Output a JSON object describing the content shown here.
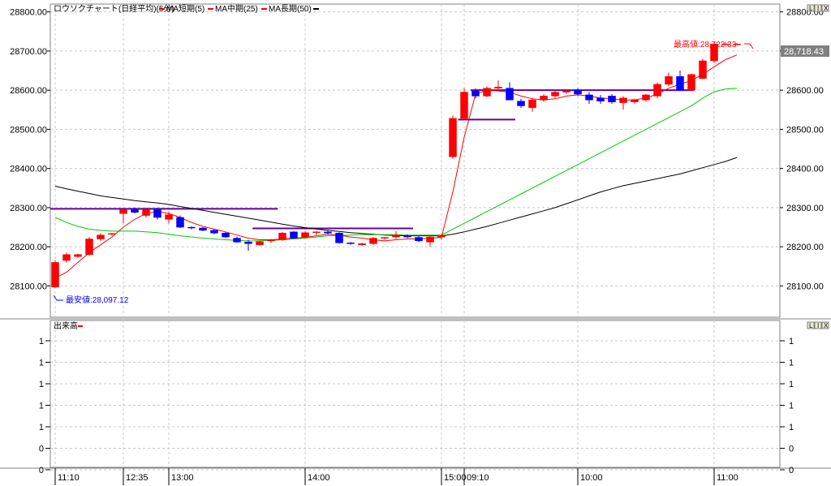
{
  "main_panel": {
    "title": "ロウソクチャート(日経平均)(5分)",
    "legend": [
      {
        "label": "MA短期(5)",
        "color": "#ff0000"
      },
      {
        "label": "MA中期(25)",
        "color": "#ff0000"
      },
      {
        "label": "MA長期(50)",
        "color": "#000000"
      }
    ],
    "buttons": [
      "L",
      "I",
      "X"
    ],
    "y_ticks": [
      "28800.00",
      "28700.00",
      "28600.00",
      "28500.00",
      "28400.00",
      "28300.00",
      "28200.00",
      "28100.00"
    ],
    "current_price_label": "28,718.43",
    "high_annotation": "最高値:28,722.33",
    "low_annotation": "最安値:28,097.12"
  },
  "volume_panel": {
    "title": "出来高",
    "buttons": [
      "L",
      "I",
      "X"
    ],
    "y_ticks": [
      "1",
      "1",
      "1",
      "1",
      "1",
      "0",
      "0",
      "0"
    ]
  },
  "x_axis": {
    "labels": [
      "11:10",
      "12:35",
      "13:00",
      "14:00",
      "15:00",
      "09:10",
      "10:00",
      "11:00"
    ]
  },
  "colors": {
    "up": "#ff0000",
    "down": "#0000ff",
    "ma_short": "#ff0000",
    "ma_mid": "#00cc00",
    "ma_long": "#000000",
    "hline": "#660099",
    "grid": "#c8c8c8"
  },
  "chart_data": {
    "type": "candlestick",
    "ylim": [
      28020,
      28820
    ],
    "candles": [
      {
        "o": 28097,
        "h": 28165,
        "l": 28095,
        "c": 28160
      },
      {
        "o": 28165,
        "h": 28185,
        "l": 28160,
        "c": 28180
      },
      {
        "o": 28175,
        "h": 28182,
        "l": 28172,
        "c": 28180
      },
      {
        "o": 28180,
        "h": 28225,
        "l": 28178,
        "c": 28220
      },
      {
        "o": 28220,
        "h": 28235,
        "l": 28215,
        "c": 28230
      },
      {
        "o": 28232,
        "h": 28235,
        "l": 28228,
        "c": 28234
      },
      {
        "o": 28285,
        "h": 28300,
        "l": 28260,
        "c": 28295
      },
      {
        "o": 28295,
        "h": 28300,
        "l": 28285,
        "c": 28288
      },
      {
        "o": 28280,
        "h": 28300,
        "l": 28275,
        "c": 28295
      },
      {
        "o": 28295,
        "h": 28300,
        "l": 28270,
        "c": 28275
      },
      {
        "o": 28270,
        "h": 28290,
        "l": 28260,
        "c": 28282
      },
      {
        "o": 28275,
        "h": 28280,
        "l": 28248,
        "c": 28250
      },
      {
        "o": 28250,
        "h": 28252,
        "l": 28245,
        "c": 28248
      },
      {
        "o": 28248,
        "h": 28250,
        "l": 28240,
        "c": 28242
      },
      {
        "o": 28242,
        "h": 28245,
        "l": 28232,
        "c": 28235
      },
      {
        "o": 28235,
        "h": 28238,
        "l": 28222,
        "c": 28225
      },
      {
        "o": 28222,
        "h": 28226,
        "l": 28210,
        "c": 28212
      },
      {
        "o": 28212,
        "h": 28218,
        "l": 28190,
        "c": 28208
      },
      {
        "o": 28205,
        "h": 28215,
        "l": 28203,
        "c": 28213
      },
      {
        "o": 28215,
        "h": 28220,
        "l": 28210,
        "c": 28217
      },
      {
        "o": 28218,
        "h": 28238,
        "l": 28215,
        "c": 28235
      },
      {
        "o": 28238,
        "h": 28240,
        "l": 28220,
        "c": 28222
      },
      {
        "o": 28225,
        "h": 28240,
        "l": 28222,
        "c": 28236
      },
      {
        "o": 28236,
        "h": 28240,
        "l": 28230,
        "c": 28238
      },
      {
        "o": 28238,
        "h": 28242,
        "l": 28232,
        "c": 28235
      },
      {
        "o": 28235,
        "h": 28237,
        "l": 28208,
        "c": 28210
      },
      {
        "o": 28210,
        "h": 28212,
        "l": 28205,
        "c": 28208
      },
      {
        "o": 28205,
        "h": 28210,
        "l": 28203,
        "c": 28208
      },
      {
        "o": 28208,
        "h": 28225,
        "l": 28205,
        "c": 28222
      },
      {
        "o": 28222,
        "h": 28225,
        "l": 28218,
        "c": 28224
      },
      {
        "o": 28225,
        "h": 28240,
        "l": 28220,
        "c": 28230
      },
      {
        "o": 28228,
        "h": 28232,
        "l": 28222,
        "c": 28225
      },
      {
        "o": 28224,
        "h": 28228,
        "l": 28212,
        "c": 28215
      },
      {
        "o": 28212,
        "h": 28228,
        "l": 28200,
        "c": 28225
      },
      {
        "o": 28225,
        "h": 28230,
        "l": 28218,
        "c": 28228
      },
      {
        "o": 28430,
        "h": 28535,
        "l": 28425,
        "c": 28528
      },
      {
        "o": 28528,
        "h": 28605,
        "l": 28525,
        "c": 28595
      },
      {
        "o": 28598,
        "h": 28605,
        "l": 28580,
        "c": 28585
      },
      {
        "o": 28585,
        "h": 28610,
        "l": 28582,
        "c": 28605
      },
      {
        "o": 28605,
        "h": 28625,
        "l": 28600,
        "c": 28608
      },
      {
        "o": 28605,
        "h": 28620,
        "l": 28575,
        "c": 28575
      },
      {
        "o": 28572,
        "h": 28578,
        "l": 28555,
        "c": 28560
      },
      {
        "o": 28555,
        "h": 28580,
        "l": 28545,
        "c": 28575
      },
      {
        "o": 28575,
        "h": 28590,
        "l": 28570,
        "c": 28585
      },
      {
        "o": 28585,
        "h": 28598,
        "l": 28580,
        "c": 28595
      },
      {
        "o": 28595,
        "h": 28602,
        "l": 28590,
        "c": 28598
      },
      {
        "o": 28600,
        "h": 28605,
        "l": 28585,
        "c": 28590
      },
      {
        "o": 28588,
        "h": 28595,
        "l": 28565,
        "c": 28575
      },
      {
        "o": 28580,
        "h": 28588,
        "l": 28565,
        "c": 28572
      },
      {
        "o": 28585,
        "h": 28590,
        "l": 28565,
        "c": 28570
      },
      {
        "o": 28568,
        "h": 28585,
        "l": 28550,
        "c": 28580
      },
      {
        "o": 28570,
        "h": 28578,
        "l": 28565,
        "c": 28576
      },
      {
        "o": 28575,
        "h": 28590,
        "l": 28570,
        "c": 28588
      },
      {
        "o": 28585,
        "h": 28620,
        "l": 28580,
        "c": 28615
      },
      {
        "o": 28615,
        "h": 28645,
        "l": 28610,
        "c": 28635
      },
      {
        "o": 28635,
        "h": 28650,
        "l": 28598,
        "c": 28600
      },
      {
        "o": 28600,
        "h": 28642,
        "l": 28598,
        "c": 28640
      },
      {
        "o": 28630,
        "h": 28680,
        "l": 28628,
        "c": 28675
      },
      {
        "o": 28675,
        "h": 28722,
        "l": 28670,
        "c": 28718
      },
      {
        "o": 28718,
        "h": 28722,
        "l": 28715,
        "c": 28718
      },
      {
        "o": 28718,
        "h": 28720,
        "l": 28716,
        "c": 28718
      }
    ],
    "ma_short": [
      28120,
      28135,
      28160,
      28185,
      28205,
      28225,
      28250,
      28270,
      28285,
      28290,
      28285,
      28275,
      28262,
      28252,
      28245,
      28238,
      28230,
      28222,
      28218,
      28218,
      28220,
      28222,
      28224,
      28228,
      28232,
      28230,
      28225,
      28222,
      28218,
      28215,
      28218,
      28220,
      28220,
      28222,
      28224,
      28340,
      28480,
      28590,
      28600,
      28598,
      28595,
      28585,
      28578,
      28575,
      28578,
      28585,
      28588,
      28585,
      28580,
      28578,
      28575,
      28575,
      28580,
      28590,
      28605,
      28615,
      28625,
      28640,
      28660,
      28678,
      28690
    ],
    "ma_mid": [
      28275,
      28262,
      28252,
      28245,
      28242,
      28240,
      28240,
      28240,
      28238,
      28236,
      28232,
      28228,
      28225,
      28222,
      28220,
      28218,
      28216,
      28215,
      28215,
      28216,
      28218,
      28220,
      28222,
      28225,
      28228,
      28229,
      28230,
      28231,
      28231,
      28231,
      28231,
      28230,
      28230,
      28230,
      28230,
      28245,
      28260,
      28275,
      28290,
      28305,
      28320,
      28335,
      28350,
      28365,
      28380,
      28395,
      28410,
      28425,
      28440,
      28455,
      28470,
      28485,
      28500,
      28515,
      28530,
      28545,
      28560,
      28580,
      28596,
      28603,
      28605
    ],
    "ma_long": [
      28355,
      28348,
      28342,
      28336,
      28330,
      28326,
      28322,
      28318,
      28315,
      28312,
      28308,
      28303,
      28298,
      28293,
      28288,
      28283,
      28278,
      28273,
      28268,
      28263,
      28258,
      28253,
      28249,
      28245,
      28242,
      28239,
      28236,
      28234,
      28232,
      28230,
      28229,
      28228,
      28228,
      28228,
      28228,
      28232,
      28238,
      28245,
      28252,
      28260,
      28268,
      28276,
      28284,
      28292,
      28300,
      28310,
      28320,
      28330,
      28340,
      28348,
      28356,
      28362,
      28368,
      28374,
      28380,
      28386,
      28394,
      28402,
      28410,
      28418,
      28428
    ],
    "hlines": [
      {
        "y": 28297,
        "i0": 0,
        "i1": 19.6
      },
      {
        "y": 28247,
        "i0": 17.8,
        "i1": 31.5
      },
      {
        "y": 28525,
        "i0": 35.9,
        "i1": 40.5
      },
      {
        "y": 28600,
        "i0": 37.0,
        "i1": 56.2
      }
    ],
    "x_tick_index": [
      0,
      6,
      10,
      22,
      34,
      36,
      46,
      58
    ],
    "volume_ylim": [
      0,
      1
    ]
  }
}
